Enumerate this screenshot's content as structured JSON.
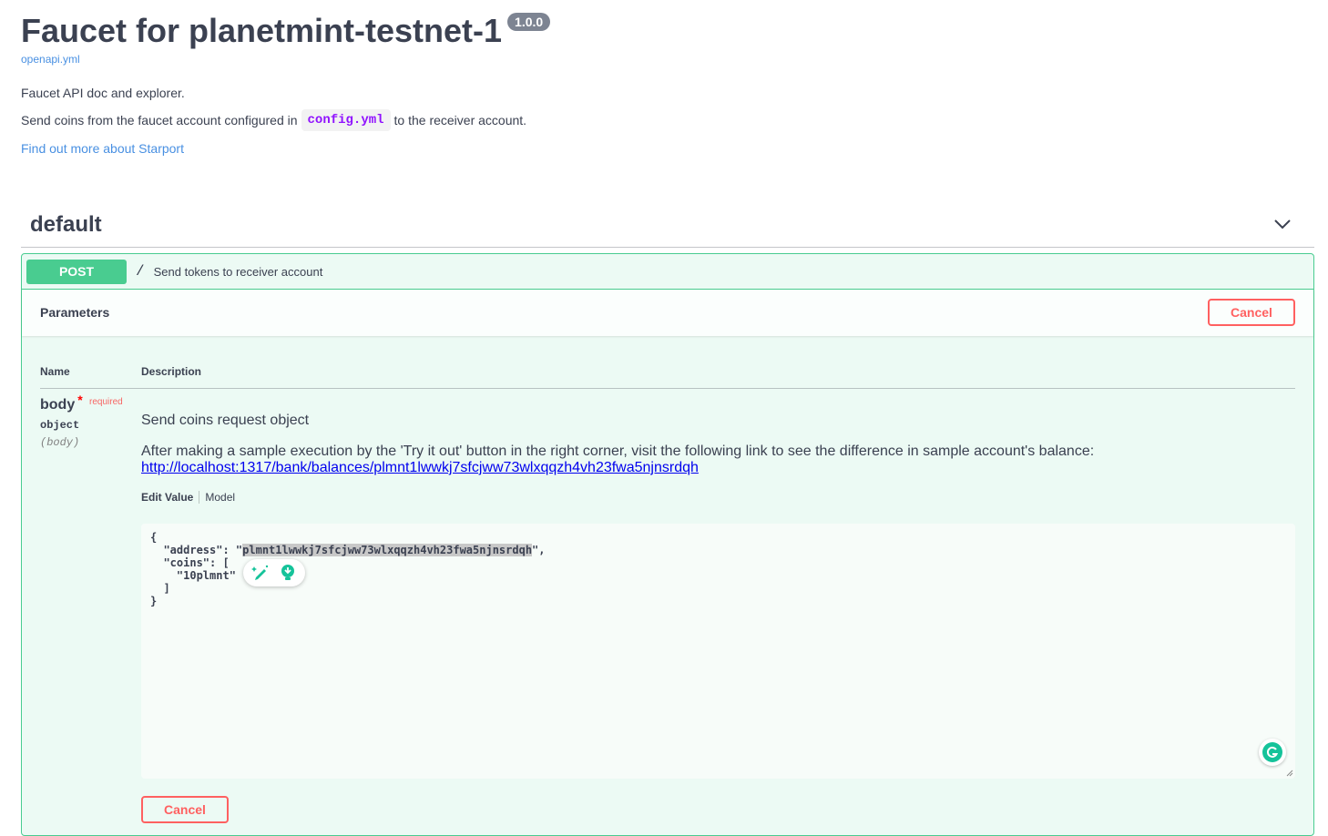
{
  "info": {
    "title": "Faucet for planetmint-testnet-1",
    "version": "1.0.0",
    "spec_link": "openapi.yml",
    "description_line1": "Faucet API doc and explorer.",
    "description_line2_before": "Send coins from the faucet account configured in",
    "description_line2_code": "config.yml",
    "description_line2_after": "to the receiver account.",
    "external_link": "Find out more about Starport"
  },
  "section": {
    "title": "default"
  },
  "operation": {
    "method": "POST",
    "path": "/",
    "summary": "Send tokens to receiver account",
    "parameters_title": "Parameters",
    "cancel_label": "Cancel",
    "columns": {
      "name": "Name",
      "description": "Description"
    },
    "param": {
      "name": "body",
      "required_mark": "*",
      "required_label": "required",
      "type": "object",
      "location": "(body)",
      "description": "Send coins request object",
      "note": "After making a sample execution by the 'Try it out' button in the right corner, visit the following link to see the difference in sample account's balance:",
      "note_link": "http://localhost:1317/bank/balances/plmnt1lwwkj7sfcjww73wlxqqzh4vh23fwa5njnsrdqh"
    },
    "tabs": {
      "edit_value": "Edit Value",
      "model": "Model"
    },
    "editor": {
      "line1": "{",
      "line2_prefix": "  \"address\": \"",
      "line2_selected": "plmnt1lwwkj7sfcjww73wlxqqzh4vh23fwa5njnsrdqh",
      "line2_suffix": "\",",
      "line3": "  \"coins\": [",
      "line4": "    \"10plmnt\"",
      "line5": "  ]",
      "line6": "}"
    }
  },
  "colors": {
    "post_green": "#49cc90",
    "cancel_red": "#ff6060",
    "link_blue": "#4990e2",
    "code_purple": "#9012fe"
  }
}
